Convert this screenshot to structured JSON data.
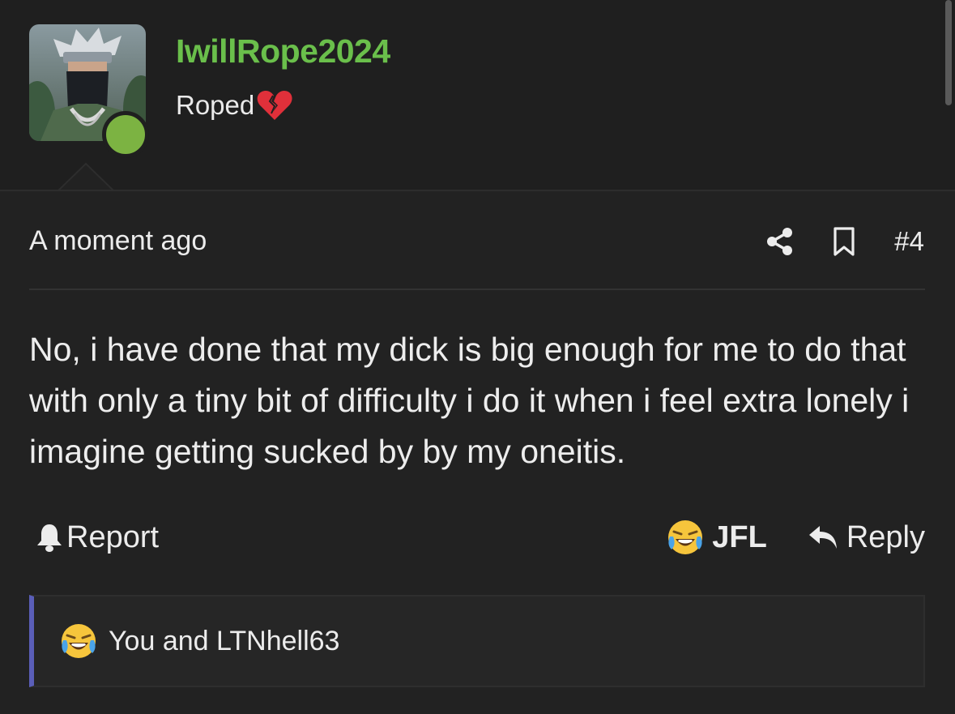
{
  "user": {
    "username": "IwillRope2024",
    "username_color": "#6abf4b",
    "title": "Roped",
    "title_icon": "broken-heart-icon",
    "online_status_color": "#7cb342"
  },
  "post": {
    "time": "A moment ago",
    "number": "#4",
    "body": "No, i have done that my dick is big enough for me to do that with only a tiny bit of difficulty i do it when i feel extra lonely i imagine getting sucked by by my oneitis.",
    "report_label": "Report",
    "reaction_label": "JFL",
    "reply_label": "Reply",
    "reactions_summary": "You and LTNhell63"
  },
  "colors": {
    "accent_bar": "#5a5eb8",
    "background": "#1f1f1f"
  }
}
